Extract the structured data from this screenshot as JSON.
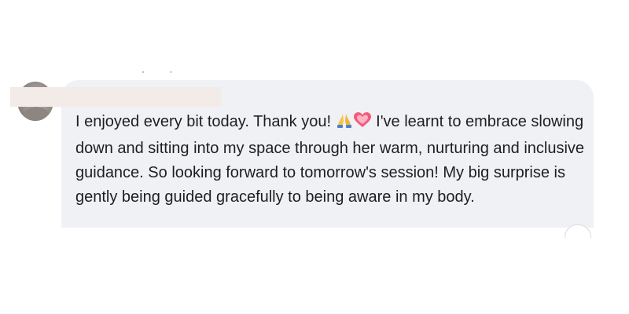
{
  "comment": {
    "text_part1": "I enjoyed every bit today. Thank you! ",
    "text_part2": " I've learnt to embrace slowing down and sitting into my space through her warm, nurturing and inclusive guidance. So looking forward to tomorrow's session! My big surprise is gently being guided gracefully to being aware in my body.",
    "emojis": [
      "folded-hands-icon",
      "heart-icon"
    ]
  },
  "header": {
    "dots": "· ·"
  },
  "colors": {
    "bubble": "#eff1f4",
    "redaction": "#f3ebe7",
    "text": "#1c1e21"
  }
}
